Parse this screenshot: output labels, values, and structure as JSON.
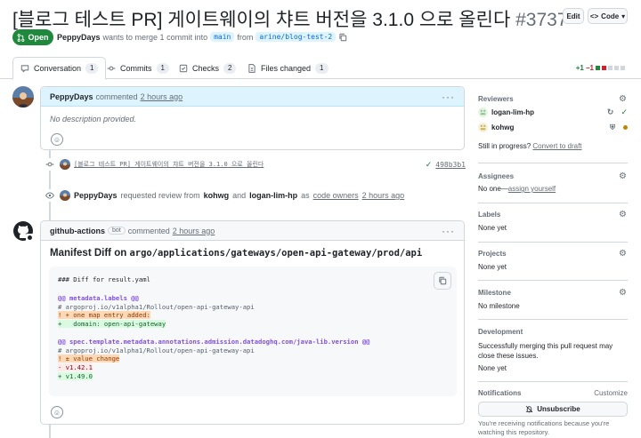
{
  "header": {
    "title": "[블로그 테스트 PR] 게이트웨이의 챠트 버전을 3.1.0 으로 올린다",
    "number": "#3737",
    "edit_label": "Edit",
    "code_label": "Code"
  },
  "status": {
    "state": "Open",
    "author": "PeppyDays",
    "merge_text": "wants to merge 1 commit into",
    "base_branch": "main",
    "from_text": "from",
    "head_branch": "arine/blog-test-2"
  },
  "tabs": [
    {
      "label": "Conversation",
      "count": "1"
    },
    {
      "label": "Commits",
      "count": "1"
    },
    {
      "label": "Checks",
      "count": "2"
    },
    {
      "label": "Files changed",
      "count": "1"
    }
  ],
  "diffstat": {
    "additions": "+1",
    "deletions": "−1"
  },
  "comment1": {
    "author": "PeppyDays",
    "action": "commented",
    "time": "2 hours ago",
    "body": "No description provided."
  },
  "commit_event": {
    "message": "[블로그 테스트 PR] 게이트웨이의 챠트 버전을 3.1.0 으로 올린다",
    "sha": "498b3b1"
  },
  "review_event": {
    "author": "PeppyDays",
    "text1": "requested review from",
    "reviewer1": "kohwg",
    "and": "and",
    "reviewer2": "logan-lim-hp",
    "as": "as",
    "owners": "code owners",
    "time": "2 hours ago"
  },
  "comment2": {
    "author": "github-actions",
    "bot_label": "bot",
    "action": "commented",
    "time": "2 hours ago",
    "heading_prefix": "Manifest Diff on",
    "heading_path": "argo/applications/gateways/open-api-gateway/prod/api",
    "code_lines": [
      "### Diff for result.yaml",
      "",
      "@@ metadata.labels @@",
      "# argoproj.io/v1alpha1/Rollout/open-api-gateway-api",
      "! + one map entry added:",
      "+   domain: open-api-gateway",
      "",
      "@@ spec.template.metadata.annotations.admission.datadoghq.com/java-lib.version @@",
      "# argoproj.io/v1alpha1/Rollout/open-api-gateway-api",
      "! ± value change",
      "- v1.42.1",
      "+ v1.49.0"
    ]
  },
  "sidebar": {
    "reviewers_title": "Reviewers",
    "reviewers": [
      {
        "name": "logan-lim-hp"
      },
      {
        "name": "kohwg"
      }
    ],
    "in_progress": "Still in progress?",
    "convert_link": "Convert to draft",
    "assignees_title": "Assignees",
    "assignees_none": "No one—",
    "assign_link": "assign yourself",
    "labels_title": "Labels",
    "labels_val": "None yet",
    "projects_title": "Projects",
    "projects_val": "None yet",
    "milestone_title": "Milestone",
    "milestone_val": "No milestone",
    "development_title": "Development",
    "development_text": "Successfully merging this pull request may close these issues.",
    "development_val": "None yet",
    "notifications_title": "Notifications",
    "customize": "Customize",
    "unsubscribe": "Unsubscribe",
    "notif_text": "You're receiving notifications because you're watching this repository."
  },
  "colors": {
    "open_green": "#1f883d",
    "link_blue": "#0969da",
    "comment_header_bg": "#ddf4ff"
  }
}
